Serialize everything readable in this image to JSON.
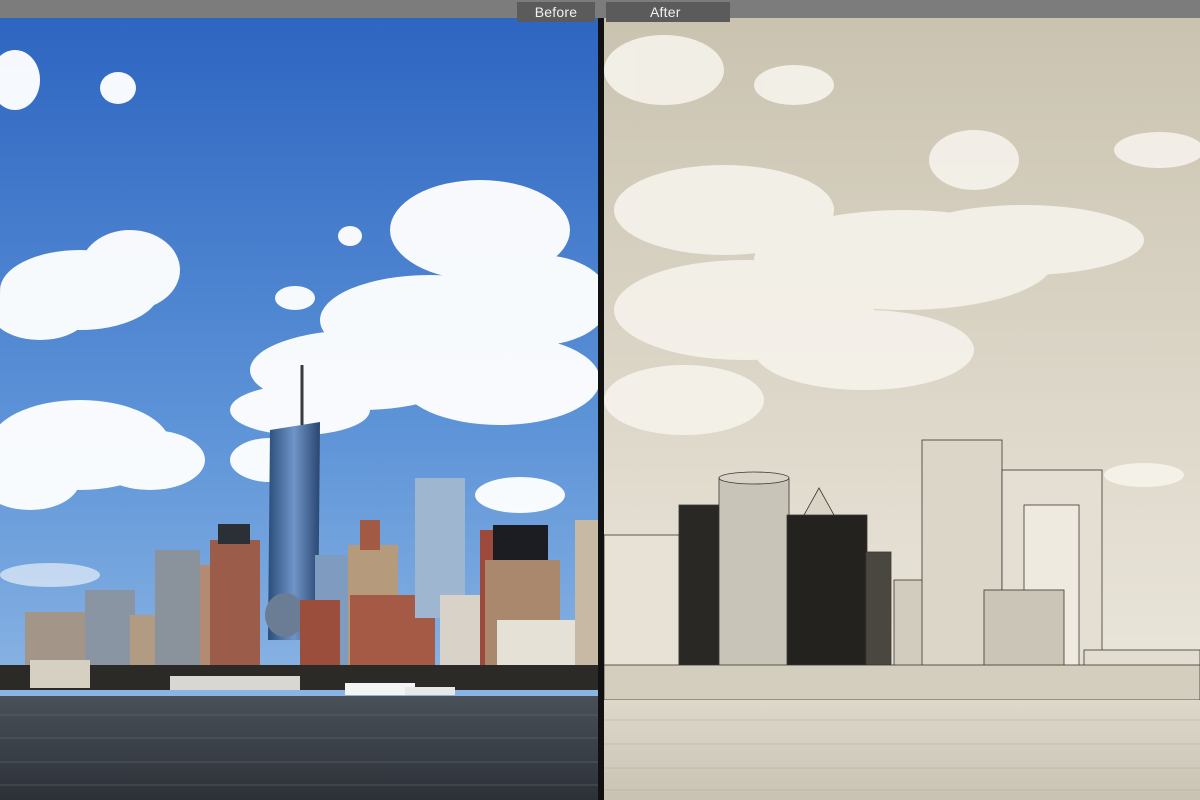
{
  "viewer": {
    "mode": "before-after-split",
    "before_label": "Before",
    "after_label": "After"
  },
  "colors": {
    "sky_top": "#2f6cc9",
    "sky_bottom": "#8fb7e6",
    "water_before": "#3a4048",
    "sepia_sky_top": "#cfc7b4",
    "sepia_sky_bottom": "#f1ede3",
    "water_after": "#d6d0c1"
  }
}
